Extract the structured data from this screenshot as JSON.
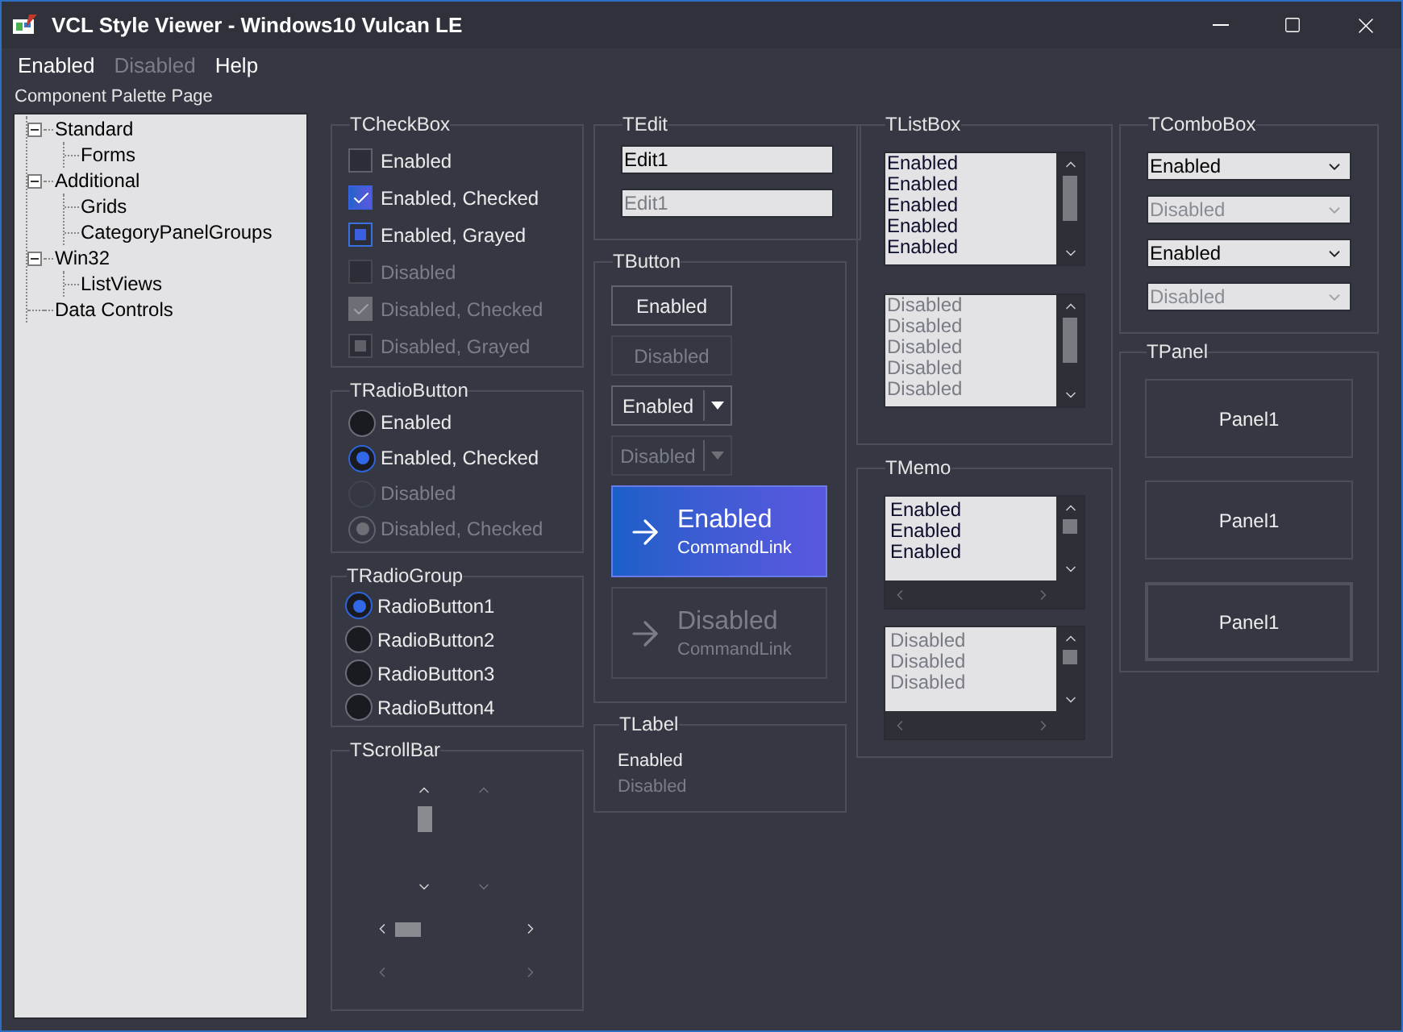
{
  "window": {
    "title": "VCL Style Viewer - Windows10 Vulcan LE"
  },
  "menu": [
    {
      "label": "Enabled",
      "disabled": false
    },
    {
      "label": "Disabled",
      "disabled": true
    },
    {
      "label": "Help",
      "disabled": false
    }
  ],
  "palette": {
    "label": "Component Palette Page",
    "tree": [
      {
        "label": "Standard",
        "expanded": true,
        "children": [
          {
            "label": "Forms"
          }
        ]
      },
      {
        "label": "Additional",
        "expanded": true,
        "children": [
          {
            "label": "Grids"
          },
          {
            "label": "CategoryPanelGroups"
          }
        ]
      },
      {
        "label": "Win32",
        "expanded": true,
        "children": [
          {
            "label": "ListViews"
          }
        ]
      },
      {
        "label": "Data Controls"
      }
    ]
  },
  "checkbox_group": {
    "title": "TCheckBox",
    "items": [
      {
        "label": "Enabled",
        "checked": false,
        "grayed": false,
        "disabled": false
      },
      {
        "label": "Enabled, Checked",
        "checked": true,
        "grayed": false,
        "disabled": false
      },
      {
        "label": "Enabled, Grayed",
        "checked": false,
        "grayed": true,
        "disabled": false
      },
      {
        "label": "Disabled",
        "checked": false,
        "grayed": false,
        "disabled": true
      },
      {
        "label": "Disabled, Checked",
        "checked": true,
        "grayed": false,
        "disabled": true
      },
      {
        "label": "Disabled, Grayed",
        "checked": false,
        "grayed": true,
        "disabled": true
      }
    ]
  },
  "radio_button_group": {
    "title": "TRadioButton",
    "items": [
      {
        "label": "Enabled",
        "checked": false,
        "disabled": false
      },
      {
        "label": "Enabled, Checked",
        "checked": true,
        "disabled": false
      },
      {
        "label": "Disabled",
        "checked": false,
        "disabled": true
      },
      {
        "label": "Disabled, Checked",
        "checked": true,
        "disabled": true
      }
    ]
  },
  "radio_group": {
    "title": "TRadioGroup",
    "items": [
      {
        "label": "RadioButton1",
        "selected": true
      },
      {
        "label": "RadioButton2",
        "selected": false
      },
      {
        "label": "RadioButton3",
        "selected": false
      },
      {
        "label": "RadioButton4",
        "selected": false
      }
    ]
  },
  "scrollbar_group": {
    "title": "TScrollBar",
    "vertical_bars": [
      {
        "disabled": false
      },
      {
        "disabled": true
      }
    ],
    "horizontal_bars": [
      {
        "disabled": false
      },
      {
        "disabled": true
      }
    ]
  },
  "edit_group": {
    "title": "TEdit",
    "fields": [
      {
        "value": "Edit1",
        "disabled": false
      },
      {
        "value": "Edit1",
        "disabled": true
      }
    ]
  },
  "button_group": {
    "title": "TButton",
    "buttons": [
      {
        "kind": "push",
        "label": "Enabled",
        "disabled": false
      },
      {
        "kind": "push",
        "label": "Disabled",
        "disabled": true
      },
      {
        "kind": "split",
        "label": "Enabled",
        "disabled": false
      },
      {
        "kind": "split",
        "label": "Disabled",
        "disabled": true
      },
      {
        "kind": "command_link",
        "label": "Enabled",
        "note": "CommandLink",
        "disabled": false
      },
      {
        "kind": "command_link",
        "label": "Disabled",
        "note": "CommandLink",
        "disabled": true
      }
    ]
  },
  "label_group": {
    "title": "TLabel",
    "labels": [
      {
        "text": "Enabled",
        "disabled": false
      },
      {
        "text": "Disabled",
        "disabled": true
      }
    ]
  },
  "listbox_group": {
    "title": "TListBox",
    "lists": [
      {
        "disabled": false,
        "items": [
          "Enabled",
          "Enabled",
          "Enabled",
          "Enabled",
          "Enabled"
        ]
      },
      {
        "disabled": true,
        "items": [
          "Disabled",
          "Disabled",
          "Disabled",
          "Disabled",
          "Disabled"
        ]
      }
    ]
  },
  "memo_group": {
    "title": "TMemo",
    "memos": [
      {
        "disabled": false,
        "lines": [
          "Enabled",
          "Enabled",
          "Enabled"
        ]
      },
      {
        "disabled": true,
        "lines": [
          "Disabled",
          "Disabled",
          "Disabled"
        ]
      }
    ]
  },
  "combobox_group": {
    "title": "TComboBox",
    "combos": [
      {
        "value": "Enabled",
        "disabled": false
      },
      {
        "value": "Disabled",
        "disabled": true
      },
      {
        "value": "Enabled",
        "disabled": false
      },
      {
        "value": "Disabled",
        "disabled": true
      }
    ]
  },
  "panel_group": {
    "title": "TPanel",
    "panels": [
      {
        "label": "Panel1",
        "thick": false
      },
      {
        "label": "Panel1",
        "thick": false
      },
      {
        "label": "Panel1",
        "thick": true
      }
    ]
  }
}
